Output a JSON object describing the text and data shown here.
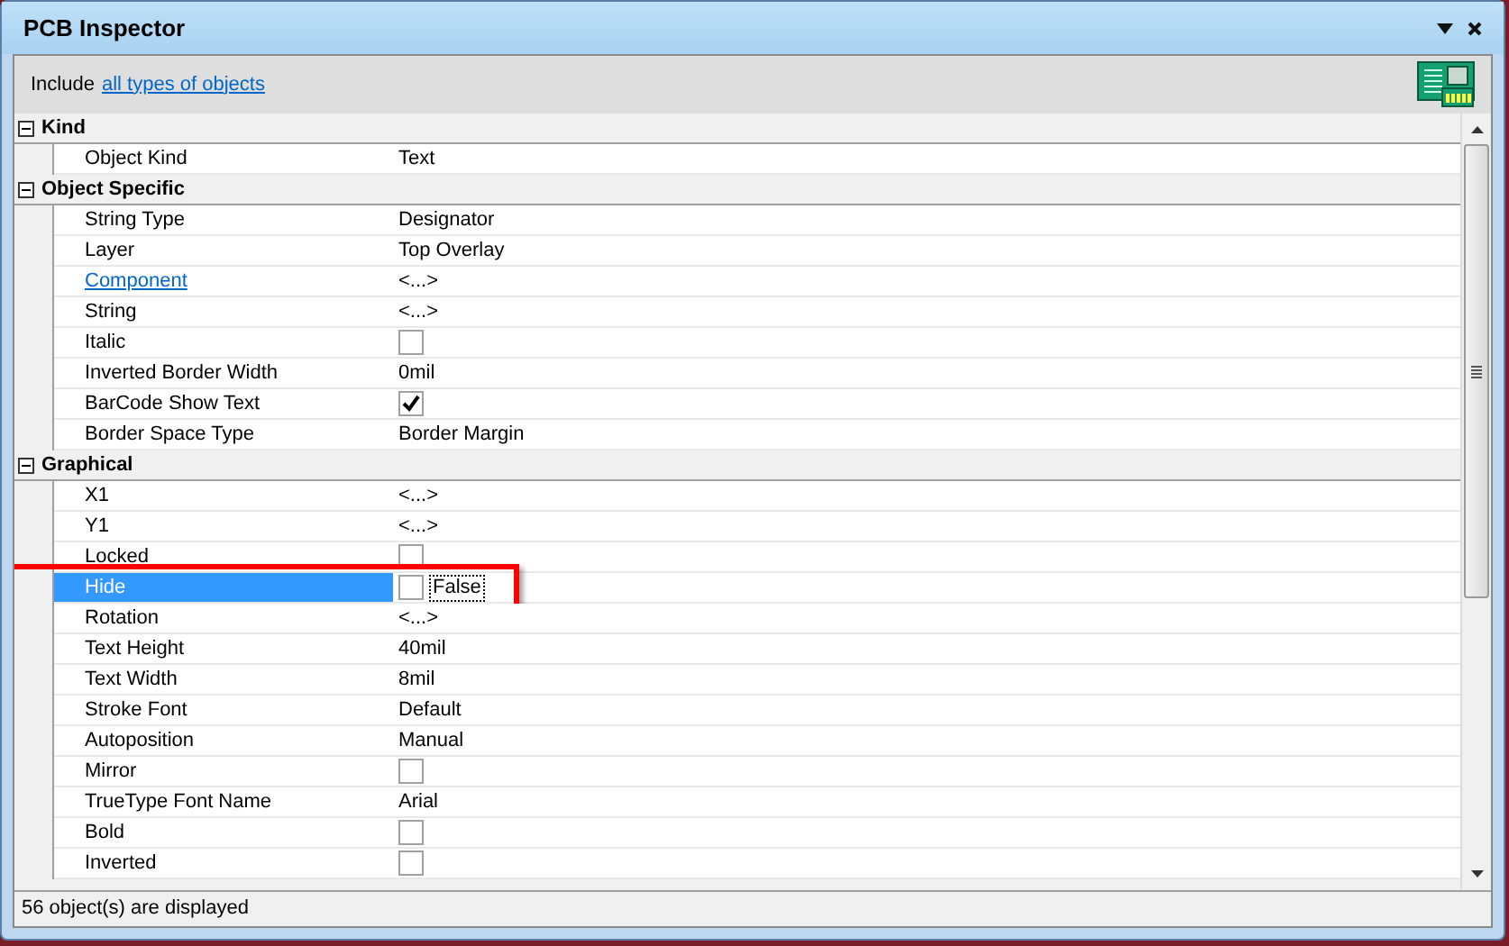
{
  "window": {
    "title": "PCB Inspector"
  },
  "filter": {
    "label": "Include",
    "link": "all types of objects"
  },
  "groups": [
    {
      "title": "Kind",
      "expanded": true,
      "rows": [
        {
          "name": "Object Kind",
          "kind": "text",
          "value": "Text",
          "selected": false
        }
      ]
    },
    {
      "title": "Object Specific",
      "expanded": true,
      "rows": [
        {
          "name": "String Type",
          "kind": "text",
          "value": "Designator",
          "selected": false
        },
        {
          "name": "Layer",
          "kind": "text",
          "value": "Top Overlay",
          "selected": false
        },
        {
          "name": "Component",
          "kind": "text",
          "value": "<...>",
          "selected": false,
          "link": true
        },
        {
          "name": "String",
          "kind": "text",
          "value": "<...>",
          "selected": false
        },
        {
          "name": "Italic",
          "kind": "checkbox",
          "checked": false,
          "selected": false
        },
        {
          "name": "Inverted Border Width",
          "kind": "text",
          "value": "0mil",
          "selected": false
        },
        {
          "name": "BarCode Show Text",
          "kind": "checkbox",
          "checked": true,
          "selected": false
        },
        {
          "name": "Border Space Type",
          "kind": "text",
          "value": "Border Margin",
          "selected": false
        }
      ]
    },
    {
      "title": "Graphical",
      "expanded": true,
      "rows": [
        {
          "name": "X1",
          "kind": "text",
          "value": "<...>",
          "selected": false
        },
        {
          "name": "Y1",
          "kind": "text",
          "value": "<...>",
          "selected": false
        },
        {
          "name": "Locked",
          "kind": "checkbox",
          "checked": false,
          "selected": false
        },
        {
          "name": "Hide",
          "kind": "checkbox",
          "checked": false,
          "caption": "False",
          "selected": true
        },
        {
          "name": "Rotation",
          "kind": "text",
          "value": "<...>",
          "selected": false
        },
        {
          "name": "Text Height",
          "kind": "text",
          "value": "40mil",
          "selected": false
        },
        {
          "name": "Text Width",
          "kind": "text",
          "value": "8mil",
          "selected": false
        },
        {
          "name": "Stroke Font",
          "kind": "text",
          "value": "Default",
          "selected": false
        },
        {
          "name": "Autoposition",
          "kind": "text",
          "value": "Manual",
          "selected": false
        },
        {
          "name": "Mirror",
          "kind": "checkbox",
          "checked": false,
          "selected": false
        },
        {
          "name": "TrueType Font Name",
          "kind": "text",
          "value": "Arial",
          "selected": false
        },
        {
          "name": "Bold",
          "kind": "checkbox",
          "checked": false,
          "selected": false
        },
        {
          "name": "Inverted",
          "kind": "checkbox",
          "checked": false,
          "selected": false
        }
      ]
    }
  ],
  "status_bar": "56 object(s) are displayed"
}
